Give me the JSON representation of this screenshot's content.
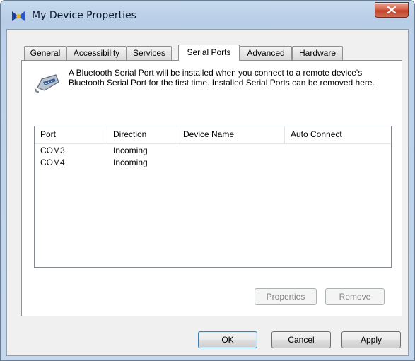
{
  "window": {
    "title": "My Device Properties"
  },
  "tabs": [
    {
      "label": "General"
    },
    {
      "label": "Accessibility"
    },
    {
      "label": "Services"
    },
    {
      "label": "Serial Ports",
      "active": true
    },
    {
      "label": "Advanced"
    },
    {
      "label": "Hardware"
    }
  ],
  "intro_text": "A Bluetooth Serial Port will be installed when you connect to a remote device's Bluetooth Serial Port for the first time. Installed Serial Ports can be removed here.",
  "list": {
    "columns": [
      "Port",
      "Direction",
      "Device Name",
      "Auto Connect"
    ],
    "rows": [
      {
        "port": "COM3",
        "direction": "Incoming",
        "device_name": "",
        "auto_connect": ""
      },
      {
        "port": "COM4",
        "direction": "Incoming",
        "device_name": "",
        "auto_connect": ""
      }
    ]
  },
  "panel_buttons": {
    "properties": "Properties",
    "remove": "Remove"
  },
  "dialog_buttons": {
    "ok": "OK",
    "cancel": "Cancel",
    "apply": "Apply"
  },
  "colors": {
    "close_button": "#c1412a",
    "frame": "#bdd2ea",
    "default_button_border": "#3c7fb1"
  },
  "icons": {
    "app": "bluetooth-device-icon",
    "panel": "serial-port-icon",
    "close": "close-icon"
  }
}
